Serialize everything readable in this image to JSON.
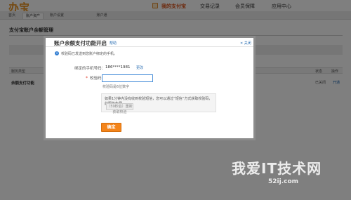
{
  "header": {
    "logo": "办宝",
    "nav": [
      "我的支付宝",
      "交易记录",
      "会员保障",
      "应用中心"
    ]
  },
  "tabs": [
    "首页",
    "账户资产",
    "账户设置",
    "账户通"
  ],
  "page": {
    "title": "支付宝账户余额管理",
    "columns": [
      "服务类型",
      "状态",
      "操作"
    ],
    "row": {
      "name": "余额支付功能",
      "status": "已关闭",
      "action": "开通"
    }
  },
  "dialog": {
    "title": "账户余额支付功能开启",
    "help": "帮助",
    "close": "关闭",
    "info": "校验码已发送到您账户绑定的手机。",
    "phone_label": "绑定的手机号码：",
    "phone_value": "186****1981",
    "change_link": "更改",
    "code_label": "校验码：",
    "code_value": "",
    "code_hint": "校验码是6位数字",
    "note": "如果1分钟内没有收到校验短信，您可以通过“短信”方式获取校验码，此服务免费。",
    "resend_label": "（59秒后）重新获取校验",
    "confirm_label": "确定"
  },
  "watermark": {
    "text": "我爱IT技术网",
    "sub": "52ij.com"
  },
  "colors": {
    "accent": "#f4841a",
    "link": "#2b6fb3",
    "required": "#e23c2a"
  }
}
